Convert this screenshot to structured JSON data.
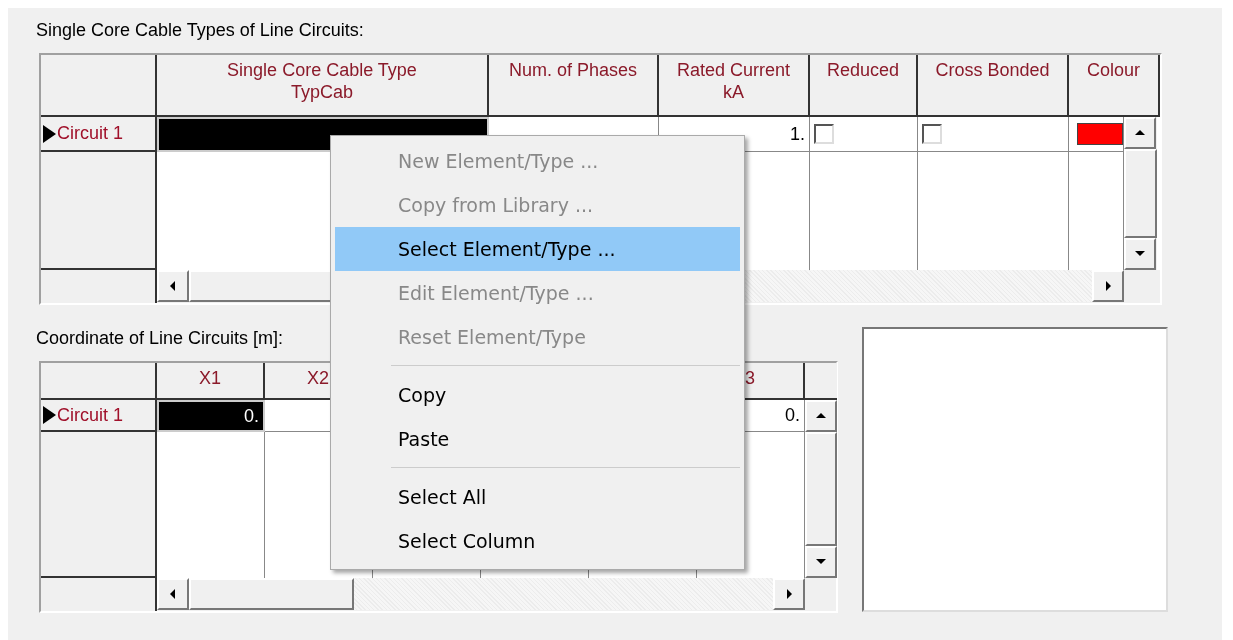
{
  "cable_grid": {
    "label": "Single Core Cable Types of Line Circuits:",
    "columns": [
      {
        "title": "Single Core Cable Type",
        "unit": "TypCab"
      },
      {
        "title": "Num. of Phases"
      },
      {
        "title": "Rated Current",
        "unit": "kA"
      },
      {
        "title": "Reduced"
      },
      {
        "title": "Cross Bonded"
      },
      {
        "title": "Colour"
      }
    ],
    "rows": [
      {
        "header": "Circuit 1",
        "current": true,
        "cable_type": {
          "selected": true
        },
        "rated_current": "1.",
        "reduced": {
          "checked": false
        },
        "cross_bonded": {
          "checked": false
        },
        "color": "#ff0000"
      }
    ]
  },
  "coordinate_grid": {
    "label": "Coordinate of Line Circuits [m]:",
    "columns": [
      {
        "label": "X1"
      },
      {
        "label": "X2"
      },
      {},
      {},
      {},
      {
        "label": "3"
      }
    ],
    "rows": [
      {
        "header": "Circuit 1",
        "current": true,
        "cells": [
          {
            "value": "0.",
            "selected": true
          },
          {
            "selected": false
          },
          {},
          {},
          {},
          {
            "value": "0.",
            "selected": false
          }
        ]
      }
    ]
  },
  "context_menu": {
    "items": [
      {
        "kind": "item",
        "label": "New Element/Type ...",
        "disabled": true,
        "selected": false
      },
      {
        "kind": "item",
        "label": "Copy from Library ...",
        "disabled": true,
        "selected": false
      },
      {
        "kind": "item",
        "label": "Select Element/Type ...",
        "disabled": false,
        "selected": true
      },
      {
        "kind": "item",
        "label": "Edit Element/Type ...",
        "disabled": true,
        "selected": false
      },
      {
        "kind": "item",
        "label": "Reset Element/Type",
        "disabled": true,
        "selected": false
      },
      {
        "kind": "separator"
      },
      {
        "kind": "item",
        "label": "Copy",
        "disabled": false,
        "selected": false
      },
      {
        "kind": "item",
        "label": "Paste",
        "disabled": false,
        "selected": false
      },
      {
        "kind": "separator"
      },
      {
        "kind": "item",
        "label": "Select All",
        "disabled": false,
        "selected": false
      },
      {
        "kind": "item",
        "label": "Select Column",
        "disabled": false,
        "selected": false
      }
    ]
  }
}
